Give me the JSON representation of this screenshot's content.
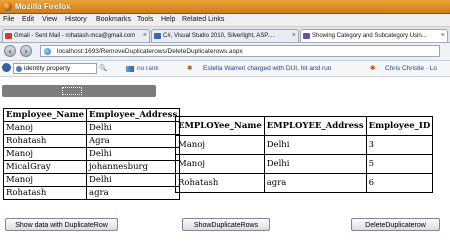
{
  "window": {
    "title": "Mozilla Firefox"
  },
  "menu": [
    "File",
    "Edit",
    "View",
    "History",
    "Bookmarks",
    "Tools",
    "Help",
    "Related Links"
  ],
  "tabs": [
    {
      "label": "Gmail - Sent Mail - rohatash.mca@gmail.com"
    },
    {
      "label": "C#, Visual Studio 2010, Silverlight, ASP...."
    },
    {
      "label": "Showing Category and Subcategory Usin..."
    }
  ],
  "nav": {
    "url": "localhost:1693/RemoveDuplicaterows/DeleteDuplicaterows.aspx"
  },
  "toolbar": {
    "search_value": "identity property",
    "no_rank": "no rank",
    "news1": "Estella Warren charged with DUI, hit and run",
    "news2": "Chris Christie · Lo"
  },
  "table1": {
    "headers": [
      "Employee_Name",
      "Employee_Address"
    ],
    "rows": [
      [
        "Manoj",
        "Delhi"
      ],
      [
        "Rohatash",
        "Agra"
      ],
      [
        "Manoj",
        "Delhi"
      ],
      [
        "MicalGray",
        "johannesburg"
      ],
      [
        "Manoj",
        "Delhi"
      ],
      [
        "Rohatash",
        "agra"
      ]
    ]
  },
  "table2": {
    "headers": [
      "EMPLOYee_Name",
      "EMPLOYEE_Address",
      "Employee_ID"
    ],
    "rows": [
      [
        "Manoj",
        "Delhi",
        "3"
      ],
      [
        "Manoj",
        "Delhi",
        "5"
      ],
      [
        "Rohatash",
        "agra",
        "6"
      ]
    ]
  },
  "buttons": {
    "show_dup": "Show data with DuplicateRow",
    "show_rows": "ShowDuplicateRows",
    "delete": "DeleteDuplicaterow"
  }
}
